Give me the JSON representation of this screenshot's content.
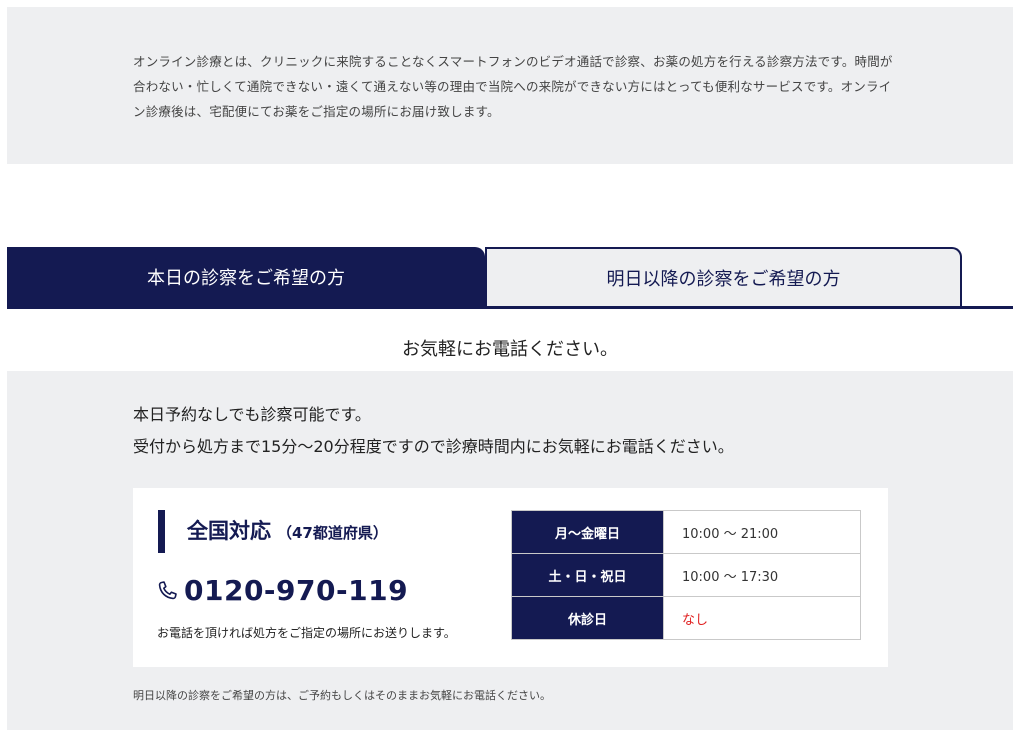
{
  "intro": {
    "text": "オンライン診療とは、クリニックに来院することなくスマートフォンのビデオ通話で診察、お薬の処方を行える診察方法です。時間が合わない・忙しくて通院できない・遠くて通えない等の理由で当院への来院ができない方にはとっても便利なサービスです。オンライン診療後は、宅配便にてお薬をご指定の場所にお届け致します。"
  },
  "tabs": {
    "today": "本日の診察をご希望の方",
    "later": "明日以降の診察をご希望の方"
  },
  "lead": "お気軽にお電話ください。",
  "panel": {
    "line1": "本日予約なしでも診察可能です。",
    "line2": "受付から処方まで15分～20分程度ですので診療時間内にお気軽にお電話ください。"
  },
  "card": {
    "title": "全国対応",
    "title_sub": "（47都道府県）",
    "phone_icon": "phone-icon",
    "phone": "0120-970-119",
    "note": "お電話を頂ければ処方をご指定の場所にお送りします。"
  },
  "hours": [
    {
      "day": "月～金曜日",
      "time": "10:00 ～ 21:00"
    },
    {
      "day": "土・日・祝日",
      "time": "10:00 ～ 17:30"
    },
    {
      "day": "休診日",
      "time": "なし"
    }
  ],
  "footnote": "明日以降の診察をご希望の方は、ご予約もしくはそのままお気軽にお電話ください。",
  "colors": {
    "navy": "#141a52",
    "panel_bg": "#eeeff1",
    "closed_red": "#e02020"
  }
}
